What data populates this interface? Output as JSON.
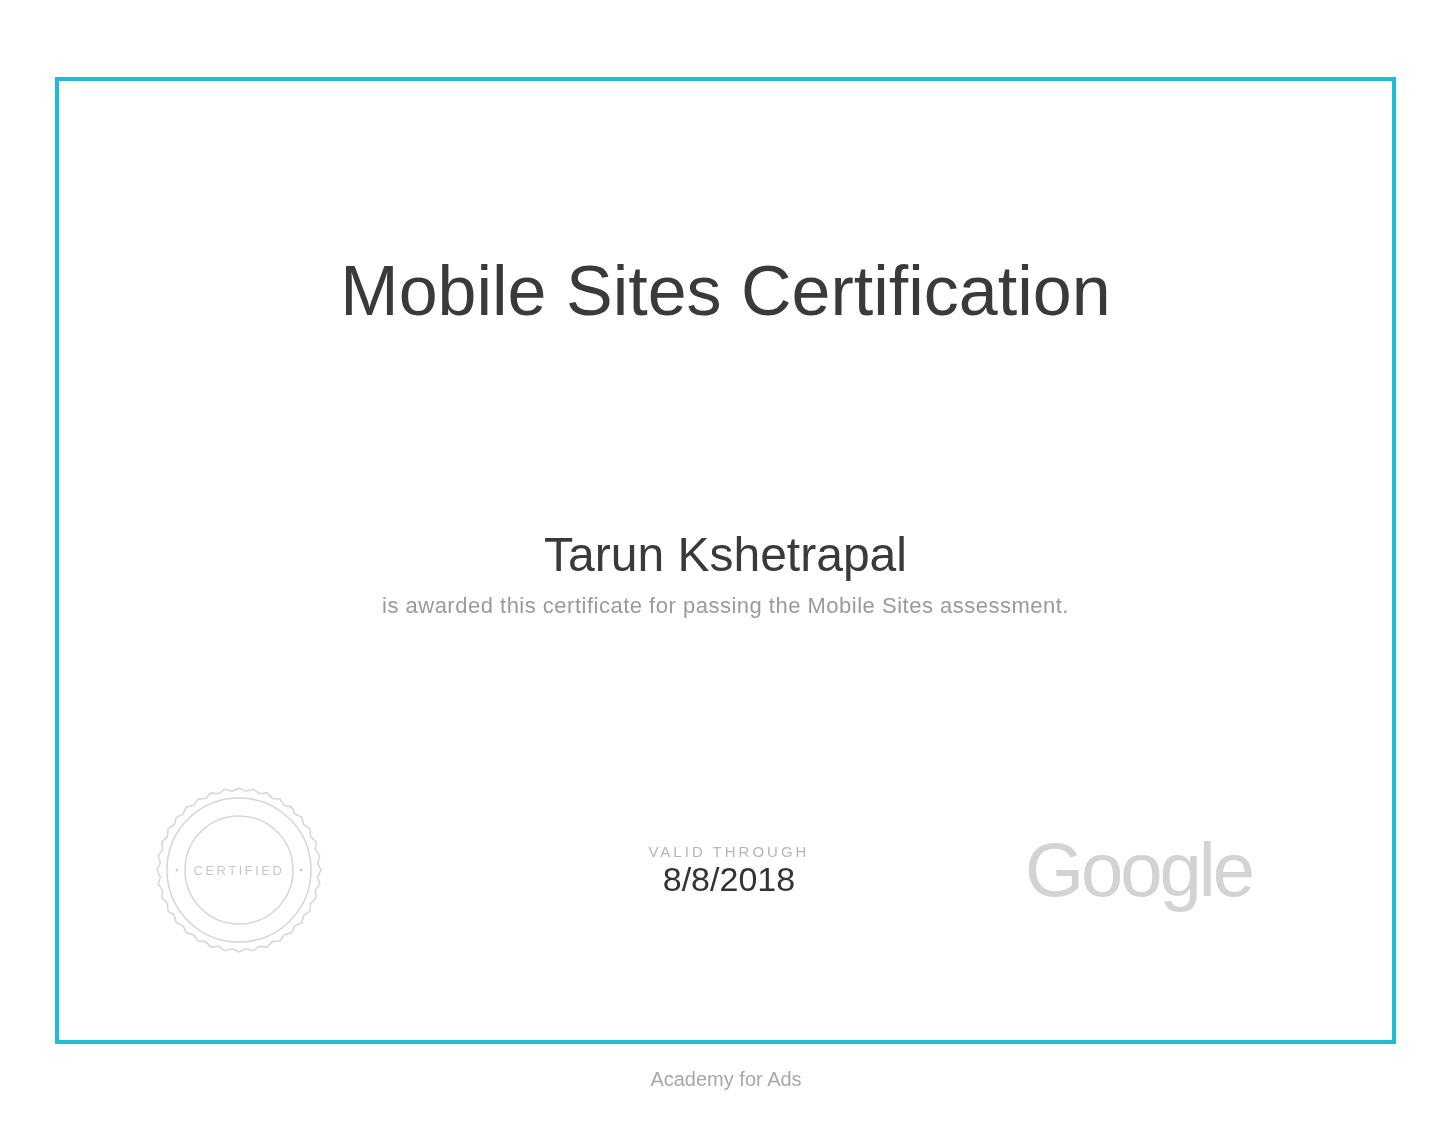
{
  "certificate": {
    "title": "Mobile Sites Certification",
    "recipient": "Tarun Kshetrapal",
    "statement": "is awarded this certificate for passing the Mobile Sites assessment.",
    "seal_text": "CERTIFIED",
    "valid_label": "VALID THROUGH",
    "valid_date": "8/8/2018",
    "logo_text": "Google"
  },
  "footer": "Academy for Ads"
}
